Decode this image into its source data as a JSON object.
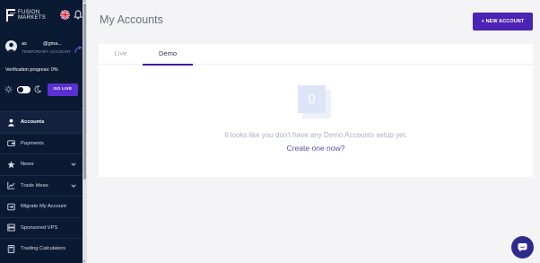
{
  "sidebar": {
    "logo": {
      "line1": "FUSION",
      "line2": "MARKETS"
    },
    "user": {
      "name": "as",
      "email": "@gma...",
      "status": "TEMPORARY ACCOUNT"
    },
    "verification": "Verification progress: 0%",
    "go_live_label": "GO LIVE",
    "nav_items": [
      {
        "label": "Accounts",
        "icon": "user-icon"
      },
      {
        "label": "Payments",
        "icon": "wallet-icon"
      },
      {
        "label": "News",
        "icon": "star-icon"
      },
      {
        "label": "Trade Ideas",
        "icon": "chart-icon"
      },
      {
        "label": "Migrate My Account",
        "icon": "migrate-icon"
      },
      {
        "label": "Sponsored VPS",
        "icon": "server-icon"
      },
      {
        "label": "Trading Calculators",
        "icon": "calculator-icon"
      }
    ]
  },
  "main": {
    "title": "My Accounts",
    "new_account_label": "+ NEW ACCOUNT",
    "tabs": [
      {
        "label": "Live"
      },
      {
        "label": "Demo"
      }
    ],
    "active_tab": "Demo",
    "empty_count": "0",
    "empty_message": "It looks like you don't have any Demo Accounts setup yet.",
    "create_link": "Create one now?"
  },
  "colors": {
    "sidebar_bg": "#0b1a33",
    "accent": "#4b24b5",
    "go_live": "#5b2fd1",
    "chat_button": "#302a8c"
  }
}
